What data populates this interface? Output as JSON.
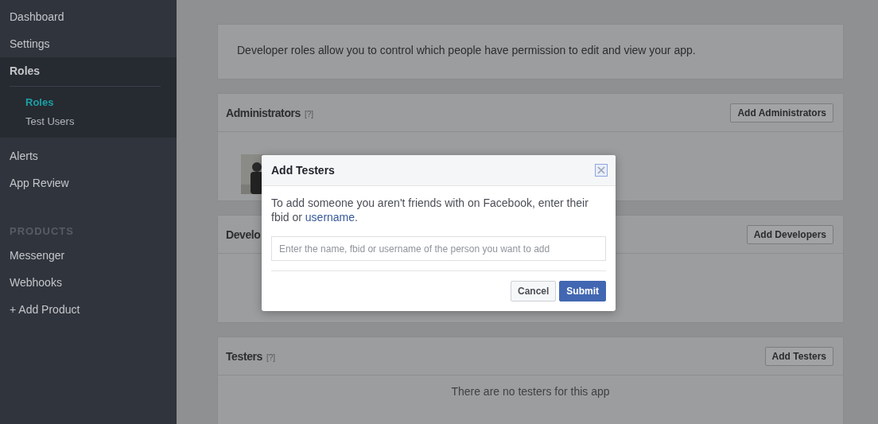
{
  "sidebar": {
    "items": [
      {
        "label": "Dashboard",
        "selected": false
      },
      {
        "label": "Settings",
        "selected": false
      },
      {
        "label": "Roles",
        "selected": true,
        "expanded": true,
        "children": [
          {
            "label": "Roles",
            "selected": true
          },
          {
            "label": "Test Users",
            "selected": false
          }
        ]
      },
      {
        "label": "Alerts",
        "selected": false
      },
      {
        "label": "App Review",
        "selected": false
      }
    ],
    "section": {
      "title": "PRODUCTS",
      "items": [
        {
          "label": "Messenger"
        },
        {
          "label": "Webhooks"
        },
        {
          "label": "+ Add Product"
        }
      ]
    }
  },
  "intro": "Developer roles allow you to control which people have permission to edit and view your app.",
  "cards": [
    {
      "title": "Administrators",
      "help": "[?]",
      "button": "Add Administrators",
      "has_picture": true
    },
    {
      "title": "Develo",
      "button": "Add Developers",
      "has_picture": false
    },
    {
      "title": "Testers",
      "help": "[?]",
      "button": "Add Testers",
      "has_picture": false,
      "empty": "There are no testers for this app"
    }
  ],
  "dialog": {
    "title": "Add Testers",
    "text": "To add someone you aren't friends with on Facebook, enter their fbid or ",
    "link": "username",
    "after_link": ".",
    "placeholder": "Enter the name, fbid or username of the person you want to add",
    "buttons": [
      {
        "label": "Cancel",
        "kind": "secondary"
      },
      {
        "label": "Submit",
        "kind": "primary"
      }
    ]
  }
}
